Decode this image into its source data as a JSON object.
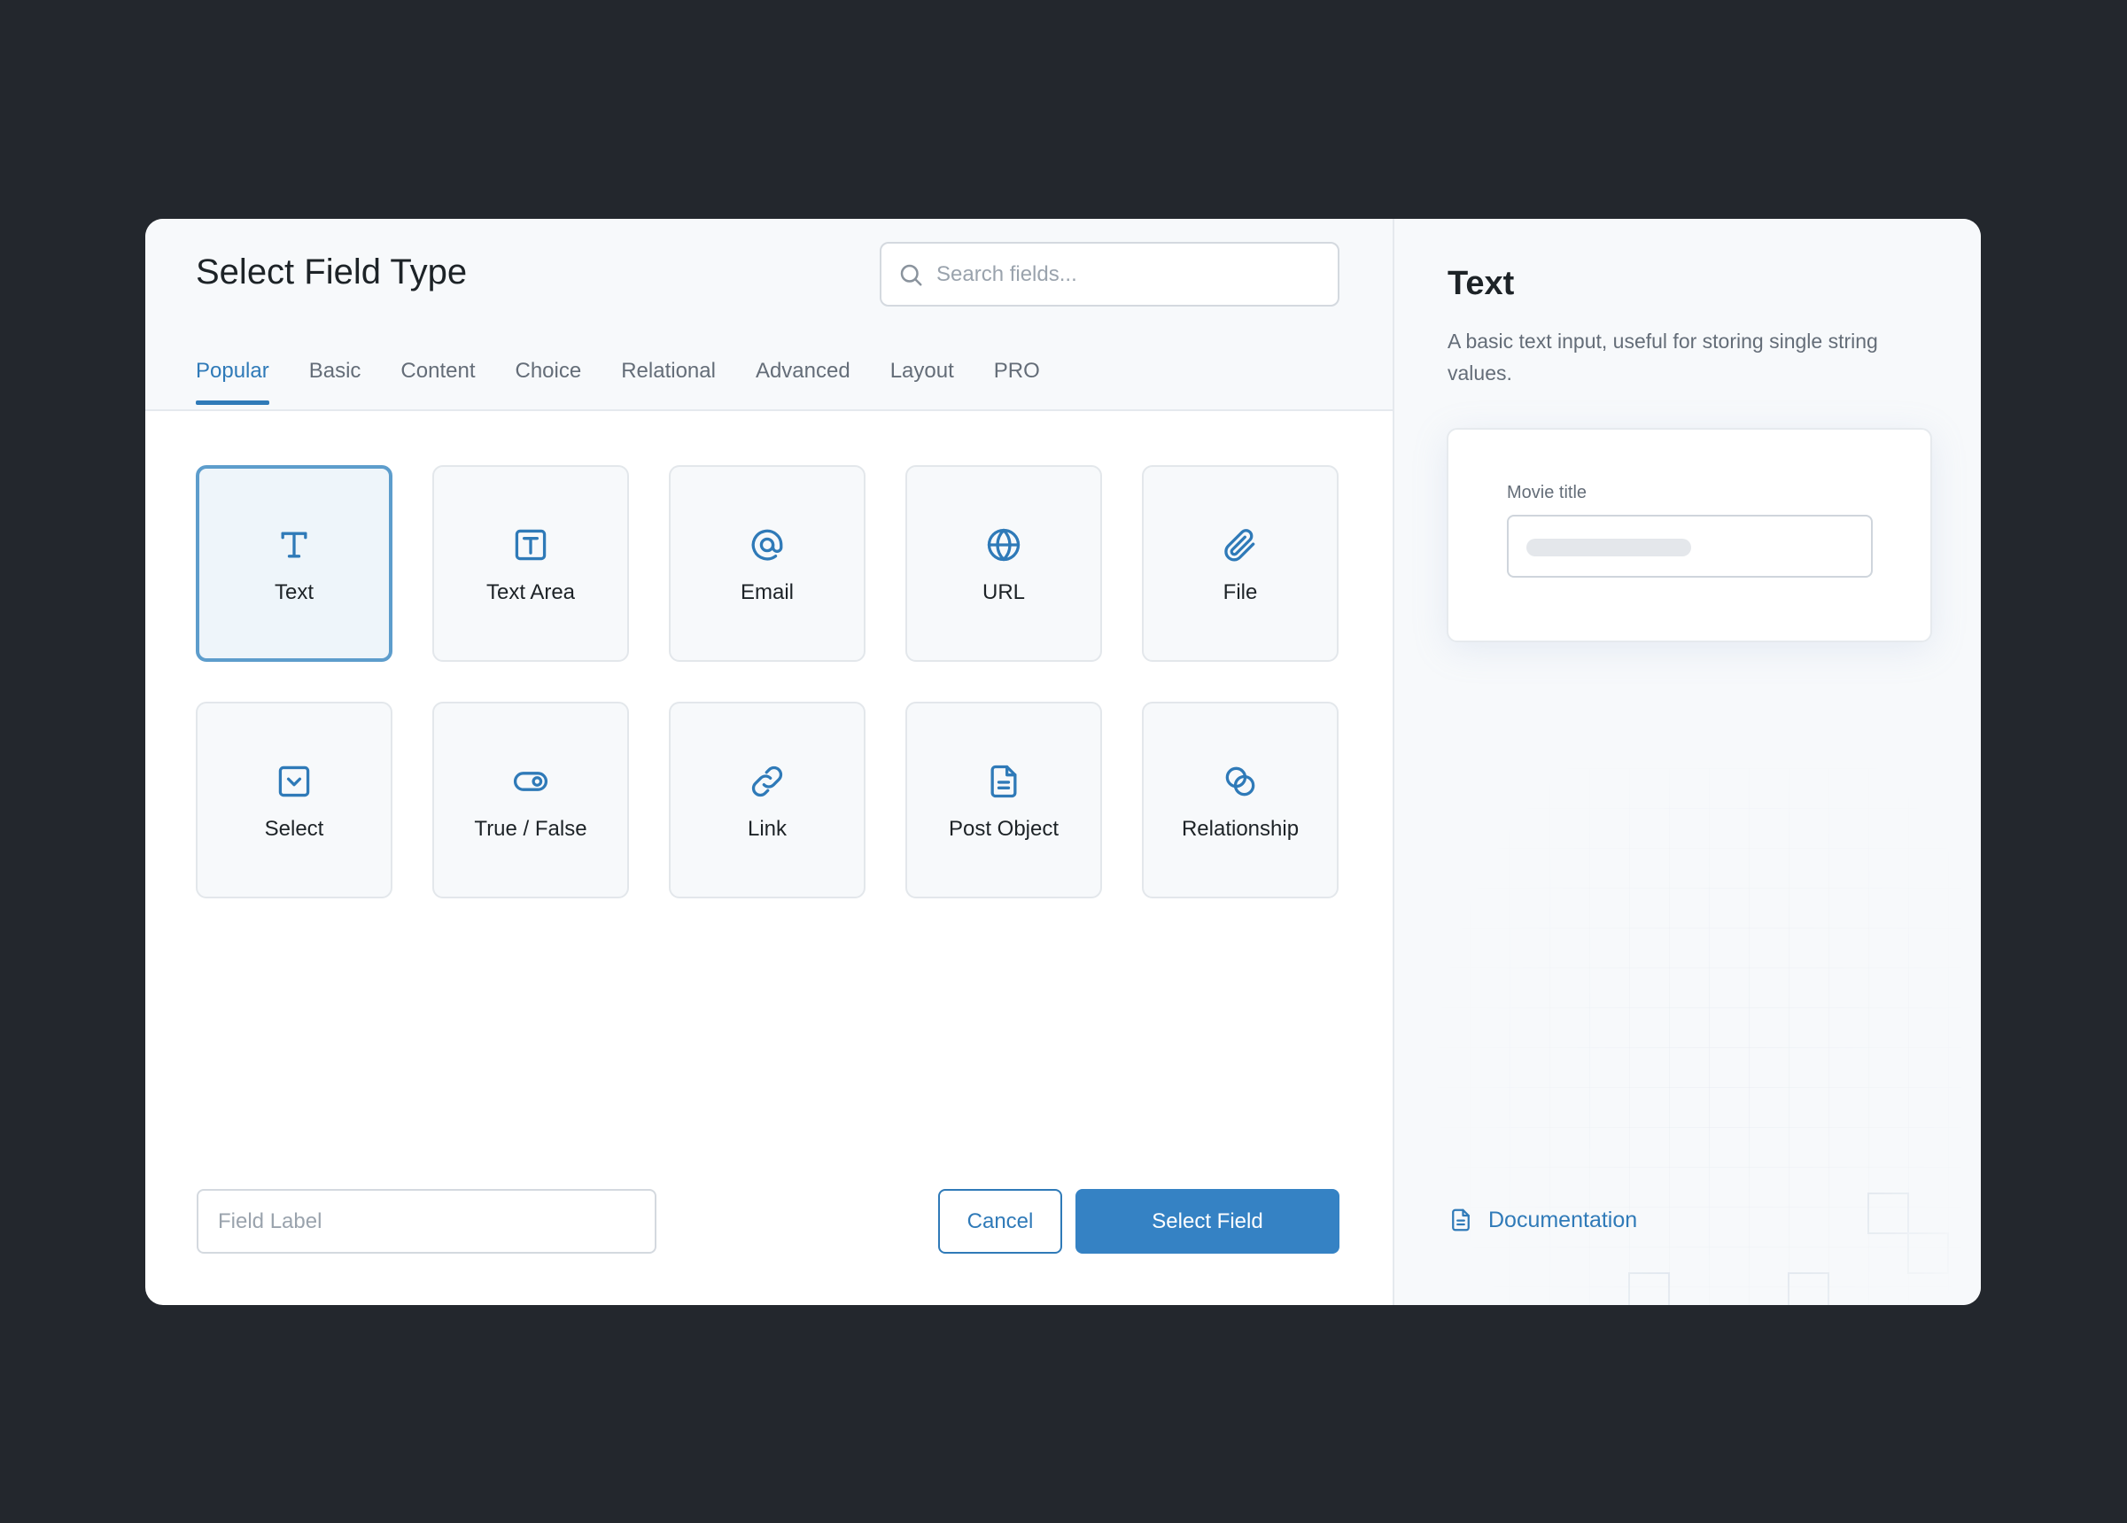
{
  "modal": {
    "title": "Select Field Type",
    "search": {
      "placeholder": "Search fields...",
      "value": ""
    },
    "tabs": [
      {
        "label": "Popular",
        "active": true
      },
      {
        "label": "Basic"
      },
      {
        "label": "Content"
      },
      {
        "label": "Choice"
      },
      {
        "label": "Relational"
      },
      {
        "label": "Advanced"
      },
      {
        "label": "Layout"
      },
      {
        "label": "PRO"
      }
    ],
    "fields": [
      {
        "label": "Text",
        "icon": "text-icon",
        "selected": true
      },
      {
        "label": "Text Area",
        "icon": "textarea-icon"
      },
      {
        "label": "Email",
        "icon": "at-icon"
      },
      {
        "label": "URL",
        "icon": "globe-icon"
      },
      {
        "label": "File",
        "icon": "paperclip-icon"
      },
      {
        "label": "Select",
        "icon": "select-icon"
      },
      {
        "label": "True / False",
        "icon": "toggle-icon"
      },
      {
        "label": "Link",
        "icon": "link-icon"
      },
      {
        "label": "Post Object",
        "icon": "document-icon"
      },
      {
        "label": "Relationship",
        "icon": "relationship-icon"
      }
    ],
    "footer": {
      "field_label_placeholder": "Field Label",
      "cancel_label": "Cancel",
      "select_label": "Select Field"
    }
  },
  "side": {
    "title": "Text",
    "description": "A basic text input, useful for storing single string values.",
    "preview_label": "Movie title",
    "documentation_label": "Documentation"
  },
  "colors": {
    "accent": "#2f7ab8",
    "primary_button": "#3582c4",
    "backdrop": "#23272d",
    "selected_border": "#5d9dcc"
  }
}
